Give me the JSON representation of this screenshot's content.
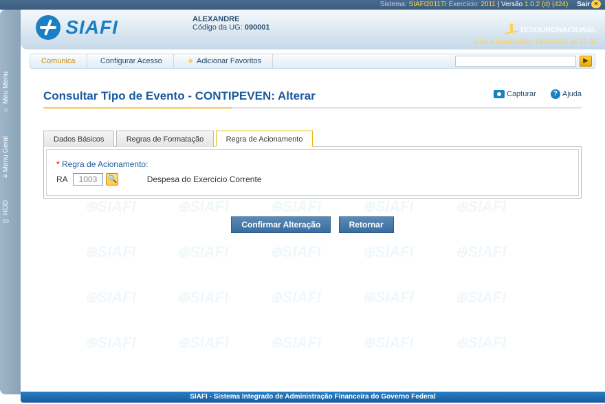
{
  "sysbar": {
    "sistema_label": "Sistema:",
    "sistema_value": "SIAFI2011TI",
    "exercicio_label": "Exercício:",
    "exercicio_value": "2011",
    "versao_label": "Versão",
    "versao_value": "1.0.2 (d) (424)",
    "sair": "Sair"
  },
  "header": {
    "logo_text": "SIAFI",
    "user_name": "ALEXANDRE",
    "ug_label": "Código da UG:",
    "ug_value": "090001",
    "tesouro": "TESOURONACIONAL",
    "last_update_label": "Última atualização:",
    "last_update_value": "19/09/2011 às 17:34"
  },
  "sidetabs": {
    "meu_menu": "Meu Menu",
    "menu_geral": "Menu Geral",
    "hod": "HOD"
  },
  "menubar": {
    "comunica": "Comunica",
    "configurar": "Configurar Acesso",
    "adicionar": "Adicionar Favoritos",
    "search_placeholder": ""
  },
  "tools": {
    "capturar": "Capturar",
    "ajuda": "Ajuda"
  },
  "page": {
    "title": "Consultar Tipo de Evento - CONTIPEVEN: Alterar"
  },
  "tabs": {
    "t1": "Dados Básicos",
    "t2": "Regras de Formatação",
    "t3": "Regra de Acionamento"
  },
  "form": {
    "label": "Regra de Acionamento:",
    "prefix": "RA",
    "code": "1003",
    "description": "Despesa do Exercício Corrente"
  },
  "buttons": {
    "confirm": "Confirmar Alteração",
    "return": "Retornar"
  },
  "footer": {
    "text": "SIAFI - Sistema Integrado de Administração Financeira do Governo Federal"
  }
}
